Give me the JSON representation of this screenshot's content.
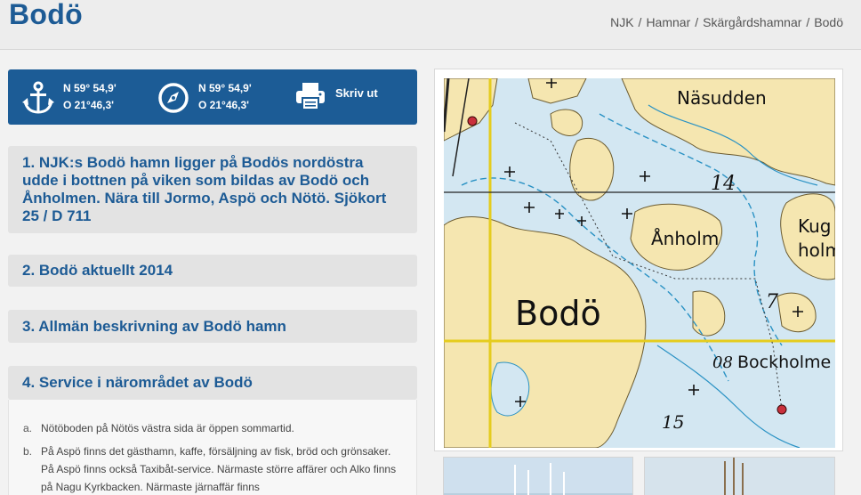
{
  "page": {
    "title": "Bodö"
  },
  "breadcrumb": [
    {
      "label": "NJK"
    },
    {
      "label": "Hamnar"
    },
    {
      "label": "Skärgårdshamnar"
    },
    {
      "label": "Bodö"
    }
  ],
  "breadcrumb_separator": "/",
  "coordinates": {
    "anchor": {
      "lat": "N 59° 54,9'",
      "lon": "O 21°46,3'",
      "icon": "anchor-icon"
    },
    "compass": {
      "lat": "N 59° 54,9'",
      "lon": "O 21°46,3'",
      "icon": "compass-icon"
    },
    "print": {
      "label": "Skriv ut",
      "icon": "printer-icon"
    }
  },
  "accordion": [
    {
      "label": "1. NJK:s Bodö hamn ligger på Bodös nordöstra udde i bottnen på viken som bildas av Bodö och Ånholmen. Nära till Jormo, Aspö och Nötö. Sjökort 25 / D 711"
    },
    {
      "label": "2. Bodö aktuellt 2014"
    },
    {
      "label": "3. Allmän beskrivning av Bodö hamn"
    },
    {
      "label": "4. Service i närområdet av Bodö"
    }
  ],
  "service_list": [
    {
      "marker": "a.",
      "text": "Nötöboden på Nötös västra sida är öppen sommartid."
    },
    {
      "marker": "b.",
      "text": "På Aspö finns det gästhamn, kaffe, försäljning av fisk, bröd och grönsaker. På Aspö finns också Taxibåt-service. Närmaste större affärer och Alko finns på Nagu Kyrkbacken. Närmaste järnaffär finns"
    }
  ],
  "map": {
    "labels": {
      "nasudden": "Näsudden",
      "anholm": "Ånholm",
      "kugg": "Kug",
      "holm": "holm",
      "bodo": "Bodö",
      "bockholm": "Bockholme",
      "depth14": "14",
      "depth7": "7",
      "depth08": "08",
      "depth15": "15"
    },
    "colors": {
      "land": "#f5e6b0",
      "water": "#d3e7f2",
      "grid": "#e5cc1e",
      "depth": "#2a92c4"
    }
  }
}
